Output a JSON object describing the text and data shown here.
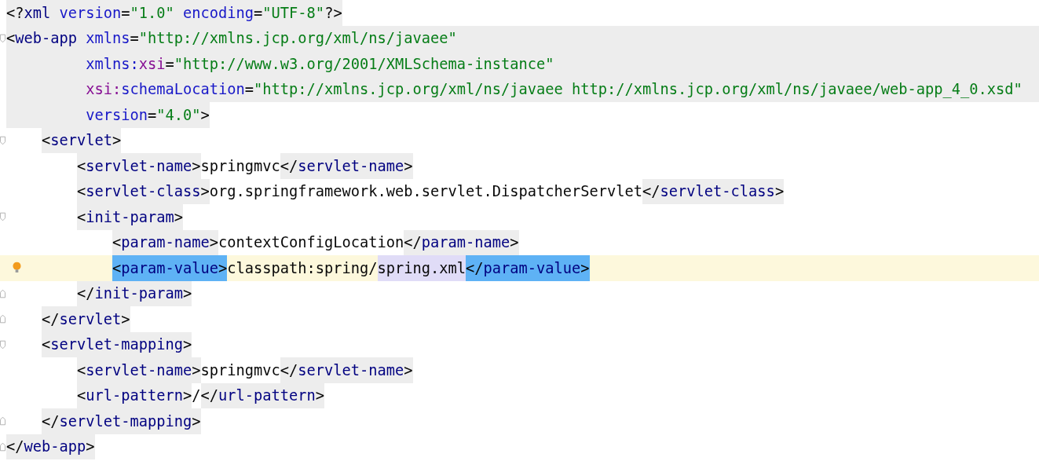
{
  "editor": {
    "lines": [
      {
        "kind": "code",
        "segments": [
          {
            "kind": "tag",
            "tokens": [
              {
                "kind": "p",
                "text": "<?"
              },
              {
                "kind": "pi",
                "text": "xml"
              },
              {
                "kind": "attr",
                "text": " version"
              },
              {
                "kind": "p",
                "text": "="
              },
              {
                "kind": "val",
                "text": "\"1.0\""
              },
              {
                "kind": "attr",
                "text": " encoding"
              },
              {
                "kind": "p",
                "text": "="
              },
              {
                "kind": "val",
                "text": "\"UTF-8\""
              },
              {
                "kind": "p",
                "text": "?>"
              }
            ]
          }
        ]
      },
      {
        "kind": "code",
        "fold_start": true,
        "fill": true,
        "segments": [
          {
            "kind": "tag",
            "tokens": [
              {
                "kind": "p",
                "text": "<"
              },
              {
                "kind": "tag",
                "text": "web-app"
              },
              {
                "kind": "attr",
                "text": " xmlns"
              },
              {
                "kind": "p",
                "text": "="
              },
              {
                "kind": "val",
                "text": "\"http://xmlns.jcp.org/xml/ns/javaee\""
              }
            ]
          }
        ]
      },
      {
        "kind": "continuation",
        "fill": true,
        "segments": [
          {
            "kind": "tag",
            "tokens": [
              {
                "kind": "attr",
                "text": "xmlns:"
              },
              {
                "kind": "ns",
                "text": "xsi"
              },
              {
                "kind": "p",
                "text": "="
              },
              {
                "kind": "val",
                "text": "\"http://www.w3.org/2001/XMLSchema-instance\""
              }
            ]
          }
        ]
      },
      {
        "kind": "continuation",
        "fill": true,
        "segments": [
          {
            "kind": "tag",
            "tokens": [
              {
                "kind": "ns",
                "text": "xsi:"
              },
              {
                "kind": "attr",
                "text": "schemaLocation"
              },
              {
                "kind": "p",
                "text": "="
              },
              {
                "kind": "val",
                "text": "\"http://xmlns.jcp.org/xml/ns/javaee http://xmlns.jcp.org/xml/ns/javaee/web-app_4_0.xsd\""
              }
            ]
          }
        ]
      },
      {
        "kind": "continuation",
        "segments": [
          {
            "kind": "tag",
            "tokens": [
              {
                "kind": "attr",
                "text": "version"
              },
              {
                "kind": "p",
                "text": "="
              },
              {
                "kind": "val",
                "text": "\"4.0\""
              },
              {
                "kind": "p",
                "text": ">"
              }
            ]
          }
        ],
        "children": [
          {
            "kind": "code",
            "fold_start": true,
            "segments": [
              {
                "kind": "tag",
                "tokens": [
                  {
                    "kind": "p",
                    "text": "<"
                  },
                  {
                    "kind": "tag",
                    "text": "servlet"
                  },
                  {
                    "kind": "p",
                    "text": ">"
                  }
                ]
              }
            ],
            "children": [
              {
                "kind": "code",
                "segments": [
                  {
                    "kind": "tag",
                    "tokens": [
                      {
                        "kind": "p",
                        "text": "<"
                      },
                      {
                        "kind": "tag",
                        "text": "servlet-name"
                      },
                      {
                        "kind": "p",
                        "text": ">"
                      }
                    ]
                  },
                  {
                    "kind": "plain",
                    "tokens": [
                      {
                        "kind": "text",
                        "text": "springmvc"
                      }
                    ]
                  },
                  {
                    "kind": "tag",
                    "tokens": [
                      {
                        "kind": "p",
                        "text": "</"
                      },
                      {
                        "kind": "tag",
                        "text": "servlet-name"
                      },
                      {
                        "kind": "p",
                        "text": ">"
                      }
                    ]
                  }
                ]
              },
              {
                "kind": "code",
                "segments": [
                  {
                    "kind": "tag",
                    "tokens": [
                      {
                        "kind": "p",
                        "text": "<"
                      },
                      {
                        "kind": "tag",
                        "text": "servlet-class"
                      },
                      {
                        "kind": "p",
                        "text": ">"
                      }
                    ]
                  },
                  {
                    "kind": "plain",
                    "tokens": [
                      {
                        "kind": "text",
                        "text": "org.springframework.web.servlet.DispatcherServlet"
                      }
                    ]
                  },
                  {
                    "kind": "tag",
                    "tokens": [
                      {
                        "kind": "p",
                        "text": "</"
                      },
                      {
                        "kind": "tag",
                        "text": "servlet-class"
                      },
                      {
                        "kind": "p",
                        "text": ">"
                      }
                    ]
                  }
                ]
              },
              {
                "kind": "code",
                "fold_start": true,
                "segments": [
                  {
                    "kind": "tag",
                    "tokens": [
                      {
                        "kind": "p",
                        "text": "<"
                      },
                      {
                        "kind": "tag",
                        "text": "init-param"
                      },
                      {
                        "kind": "p",
                        "text": ">"
                      }
                    ]
                  }
                ],
                "children": [
                  {
                    "kind": "code",
                    "segments": [
                      {
                        "kind": "tag",
                        "tokens": [
                          {
                            "kind": "p",
                            "text": "<"
                          },
                          {
                            "kind": "tag",
                            "text": "param-name"
                          },
                          {
                            "kind": "p",
                            "text": ">"
                          }
                        ]
                      },
                      {
                        "kind": "plain",
                        "tokens": [
                          {
                            "kind": "text",
                            "text": "contextConfigLocation"
                          }
                        ]
                      },
                      {
                        "kind": "tag",
                        "tokens": [
                          {
                            "kind": "p",
                            "text": "</"
                          },
                          {
                            "kind": "tag",
                            "text": "param-name"
                          },
                          {
                            "kind": "p",
                            "text": ">"
                          }
                        ]
                      }
                    ]
                  },
                  {
                    "kind": "code",
                    "bulb": true,
                    "current": true,
                    "segments": [
                      {
                        "kind": "match",
                        "tokens": [
                          {
                            "kind": "p",
                            "text": "<"
                          },
                          {
                            "kind": "tag",
                            "text": "param-value"
                          },
                          {
                            "kind": "p",
                            "text": ">"
                          }
                        ]
                      },
                      {
                        "kind": "plain",
                        "tokens": [
                          {
                            "kind": "text",
                            "text": "classpath:spring/"
                          }
                        ]
                      },
                      {
                        "kind": "reference",
                        "tokens": [
                          {
                            "kind": "text",
                            "text": "spring.xml"
                          }
                        ]
                      },
                      {
                        "kind": "match",
                        "tokens": [
                          {
                            "kind": "p",
                            "text": "</"
                          },
                          {
                            "kind": "tag",
                            "text": "param-value"
                          },
                          {
                            "kind": "p",
                            "text": ">"
                          }
                        ]
                      }
                    ]
                  }
                ]
              },
              {
                "kind": "code",
                "fold_end": true,
                "segments": [
                  {
                    "kind": "tag",
                    "tokens": [
                      {
                        "kind": "p",
                        "text": "</"
                      },
                      {
                        "kind": "tag",
                        "text": "init-param"
                      },
                      {
                        "kind": "p",
                        "text": ">"
                      }
                    ]
                  }
                ]
              }
            ]
          },
          {
            "kind": "code",
            "fold_end": true,
            "segments": [
              {
                "kind": "tag",
                "tokens": [
                  {
                    "kind": "p",
                    "text": "</"
                  },
                  {
                    "kind": "tag",
                    "text": "servlet"
                  },
                  {
                    "kind": "p",
                    "text": ">"
                  }
                ]
              }
            ]
          },
          {
            "kind": "code",
            "fold_start": true,
            "segments": [
              {
                "kind": "tag",
                "tokens": [
                  {
                    "kind": "p",
                    "text": "<"
                  },
                  {
                    "kind": "tag",
                    "text": "servlet-mapping"
                  },
                  {
                    "kind": "p",
                    "text": ">"
                  }
                ]
              }
            ],
            "children": [
              {
                "kind": "code",
                "segments": [
                  {
                    "kind": "tag",
                    "tokens": [
                      {
                        "kind": "p",
                        "text": "<"
                      },
                      {
                        "kind": "tag",
                        "text": "servlet-name"
                      },
                      {
                        "kind": "p",
                        "text": ">"
                      }
                    ]
                  },
                  {
                    "kind": "plain",
                    "tokens": [
                      {
                        "kind": "text",
                        "text": "springmvc"
                      }
                    ]
                  },
                  {
                    "kind": "tag",
                    "tokens": [
                      {
                        "kind": "p",
                        "text": "</"
                      },
                      {
                        "kind": "tag",
                        "text": "servlet-name"
                      },
                      {
                        "kind": "p",
                        "text": ">"
                      }
                    ]
                  }
                ]
              },
              {
                "kind": "code",
                "segments": [
                  {
                    "kind": "tag",
                    "tokens": [
                      {
                        "kind": "p",
                        "text": "<"
                      },
                      {
                        "kind": "tag",
                        "text": "url-pattern"
                      },
                      {
                        "kind": "p",
                        "text": ">"
                      }
                    ]
                  },
                  {
                    "kind": "plain",
                    "tokens": [
                      {
                        "kind": "text",
                        "text": "/"
                      }
                    ]
                  },
                  {
                    "kind": "tag",
                    "tokens": [
                      {
                        "kind": "p",
                        "text": "</"
                      },
                      {
                        "kind": "tag",
                        "text": "url-pattern"
                      },
                      {
                        "kind": "p",
                        "text": ">"
                      }
                    ]
                  }
                ]
              }
            ]
          },
          {
            "kind": "code",
            "fold_end": true,
            "segments": [
              {
                "kind": "tag",
                "tokens": [
                  {
                    "kind": "p",
                    "text": "</"
                  },
                  {
                    "kind": "tag",
                    "text": "servlet-mapping"
                  },
                  {
                    "kind": "p",
                    "text": ">"
                  }
                ]
              }
            ]
          }
        ]
      },
      {
        "kind": "code",
        "fold_end": true,
        "segments": [
          {
            "kind": "tag",
            "tokens": [
              {
                "kind": "p",
                "text": "</"
              },
              {
                "kind": "tag",
                "text": "web-app"
              },
              {
                "kind": "p",
                "text": ">"
              }
            ]
          }
        ]
      }
    ]
  }
}
